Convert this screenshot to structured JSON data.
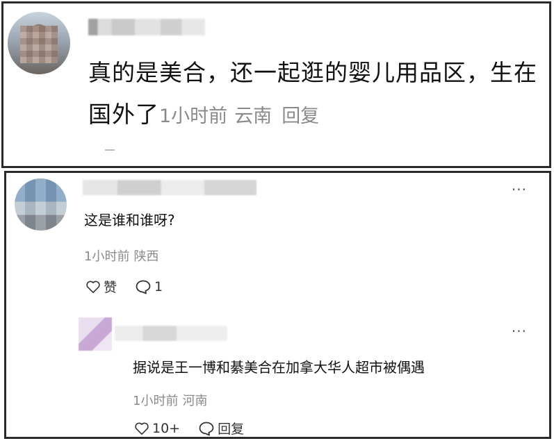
{
  "top_comment": {
    "text": "真的是美合，还一起逛的婴儿用品区，生在国外了",
    "time": "1小时前",
    "location": "云南",
    "reply_label": "回复"
  },
  "comment": {
    "text": "这是谁和谁呀?",
    "time": "1小时前",
    "location": "陕西",
    "like_label": "赞",
    "reply_count": "1",
    "more": "···"
  },
  "reply": {
    "text": "据说是王一博和綦美合在加拿大华人超市被偶遇",
    "time": "1小时前",
    "location": "河南",
    "like_count": "10+",
    "reply_label": "回复",
    "more": "···"
  },
  "colors": {
    "text": "#111111",
    "meta": "#8a8a8a",
    "border": "#2a2a2a"
  },
  "icons": [
    "heart-icon",
    "comment-bubble-icon",
    "more-dots-icon"
  ]
}
